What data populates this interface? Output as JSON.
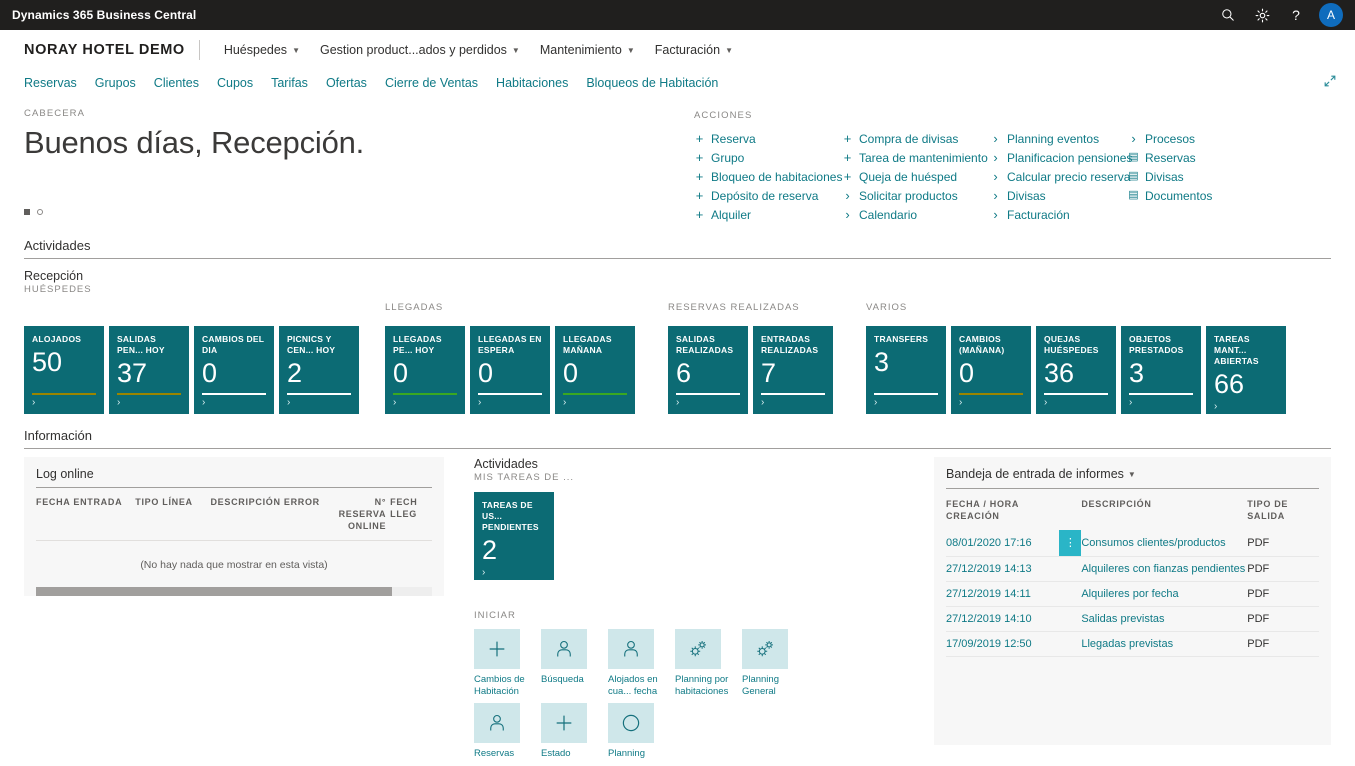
{
  "topbar": {
    "title": "Dynamics 365 Business Central",
    "search_icon": "search-icon",
    "settings_icon": "gear-icon",
    "help_icon": "question-mark-icon",
    "avatar_initial": "A"
  },
  "nav": {
    "company": "NORAY HOTEL DEMO",
    "menus": [
      {
        "label": "Huéspedes"
      },
      {
        "label": "Gestion product...ados y perdidos"
      },
      {
        "label": "Mantenimiento"
      },
      {
        "label": "Facturación"
      }
    ],
    "links": [
      "Reservas",
      "Grupos",
      "Clientes",
      "Cupos",
      "Tarifas",
      "Ofertas",
      "Cierre de Ventas",
      "Habitaciones",
      "Bloqueos de Habitación"
    ],
    "collapse_icon": "collapse-diagonal-icon"
  },
  "hero": {
    "eyebrow": "CABECERA",
    "greeting": "Buenos días, Recepción."
  },
  "actions": {
    "title": "ACCIONES",
    "columns": [
      [
        {
          "icon": "plus",
          "label": "Reserva"
        },
        {
          "icon": "plus",
          "label": "Grupo"
        },
        {
          "icon": "plus",
          "label": "Bloqueo de habitaciones"
        },
        {
          "icon": "plus",
          "label": "Depósito de reserva"
        },
        {
          "icon": "plus",
          "label": "Alquiler"
        }
      ],
      [
        {
          "icon": "plus",
          "label": "Compra de divisas"
        },
        {
          "icon": "plus",
          "label": "Tarea de mantenimiento"
        },
        {
          "icon": "plus",
          "label": "Queja de huésped"
        },
        {
          "icon": "chevron",
          "label": "Solicitar productos"
        },
        {
          "icon": "chevron",
          "label": "Calendario"
        }
      ],
      [
        {
          "icon": "chevron",
          "label": "Planning eventos"
        },
        {
          "icon": "chevron",
          "label": "Planificacion pensiones"
        },
        {
          "icon": "chevron",
          "label": "Calcular precio reserva"
        },
        {
          "icon": "chevron",
          "label": "Divisas"
        },
        {
          "icon": "chevron",
          "label": "Facturación"
        }
      ],
      [
        {
          "icon": "chevron",
          "label": "Procesos"
        },
        {
          "icon": "document",
          "label": "Reservas"
        },
        {
          "icon": "document",
          "label": "Divisas"
        },
        {
          "icon": "document",
          "label": "Documentos"
        }
      ]
    ]
  },
  "activities": {
    "section_title": "Actividades",
    "group_name": "Recepción",
    "group_sub": "HUÉSPEDES",
    "tile_groups": [
      {
        "label": "",
        "tiles": [
          {
            "label": "ALOJADOS",
            "value": "50",
            "bar": "yellow"
          },
          {
            "label": "SALIDAS PEN... HOY",
            "value": "37",
            "bar": "yellow"
          },
          {
            "label": "CAMBIOS DEL DIA",
            "value": "0",
            "bar": "white"
          },
          {
            "label": "PICNICS Y CEN... HOY",
            "value": "2",
            "bar": "white"
          }
        ]
      },
      {
        "label": "LLEGADAS",
        "tiles": [
          {
            "label": "LLEGADAS PE... HOY",
            "value": "0",
            "bar": "green"
          },
          {
            "label": "LLEGADAS EN ESPERA",
            "value": "0",
            "bar": "white"
          },
          {
            "label": "LLEGADAS MAÑANA",
            "value": "0",
            "bar": "green"
          }
        ]
      },
      {
        "label": "RESERVAS REALIZADAS",
        "tiles": [
          {
            "label": "SALIDAS REALIZADAS",
            "value": "6",
            "bar": "white"
          },
          {
            "label": "ENTRADAS REALIZADAS",
            "value": "7",
            "bar": "white"
          }
        ]
      },
      {
        "label": "VARIOS",
        "tiles": [
          {
            "label": "TRANSFERS",
            "value": "3",
            "bar": "white"
          },
          {
            "label": "CAMBIOS (MAÑANA)",
            "value": "0",
            "bar": "yellow"
          },
          {
            "label": "QUEJAS HUÉSPEDES",
            "value": "36",
            "bar": "white"
          },
          {
            "label": "OBJETOS PRESTADOS",
            "value": "3",
            "bar": "white"
          },
          {
            "label": "TAREAS MANT... ABIERTAS",
            "value": "66",
            "bar": "white"
          }
        ]
      }
    ]
  },
  "informacion": {
    "section_title": "Información",
    "log": {
      "title": "Log online",
      "headers": [
        "FECHA ENTRADA",
        "TIPO LÍNEA",
        "DESCRIPCIÓN ERROR",
        "N° RESERVA ONLINE",
        "FECH LLEG"
      ],
      "empty_message": "(No hay nada que mostrar en esta vista)"
    },
    "middle": {
      "title": "Actividades",
      "subtitle": "MIS TAREAS DE ...",
      "tile": {
        "label": "TAREAS DE US... PENDIENTES",
        "value": "2",
        "bar": "white"
      },
      "iniciar_label": "INICIAR",
      "launch_items": [
        {
          "icon": "plus-icon",
          "label": "Cambios de Habitación"
        },
        {
          "icon": "person-icon",
          "label": "Búsqueda"
        },
        {
          "icon": "person-icon",
          "label": "Alojados en cua... fecha"
        },
        {
          "icon": "gears-icon",
          "label": "Planning por habitaciones"
        },
        {
          "icon": "gears-icon",
          "label": "Planning General"
        },
        {
          "icon": "person-icon",
          "label": "Reservas"
        },
        {
          "icon": "plus-icon",
          "label": "Estado"
        },
        {
          "icon": "circle-icon",
          "label": "Planning"
        }
      ]
    },
    "reports": {
      "title": "Bandeja de entrada de informes",
      "headers": [
        "FECHA / HORA CREACIÓN",
        "DESCRIPCIÓN",
        "TIPO DE SALIDA"
      ],
      "rows": [
        {
          "date": "08/01/2020 17:16",
          "description": "Consumos clientes/productos",
          "type": "PDF",
          "selected": true
        },
        {
          "date": "27/12/2019 14:13",
          "description": "Alquileres con fianzas pendientes",
          "type": "PDF",
          "selected": false
        },
        {
          "date": "27/12/2019 14:11",
          "description": "Alquileres por fecha",
          "type": "PDF",
          "selected": false
        },
        {
          "date": "27/12/2019 14:10",
          "description": "Salidas previstas",
          "type": "PDF",
          "selected": false
        },
        {
          "date": "17/09/2019 12:50",
          "description": "Llegadas previstas",
          "type": "PDF",
          "selected": false
        }
      ]
    }
  },
  "colors": {
    "tile_teal": "#0c6b74",
    "link_teal": "#0f7a86",
    "topbar_dark": "#201f1e",
    "accent_blue": "#0f6cbd",
    "launch_box": "#cfe7ea",
    "selected_cell": "#2ab5c7"
  }
}
